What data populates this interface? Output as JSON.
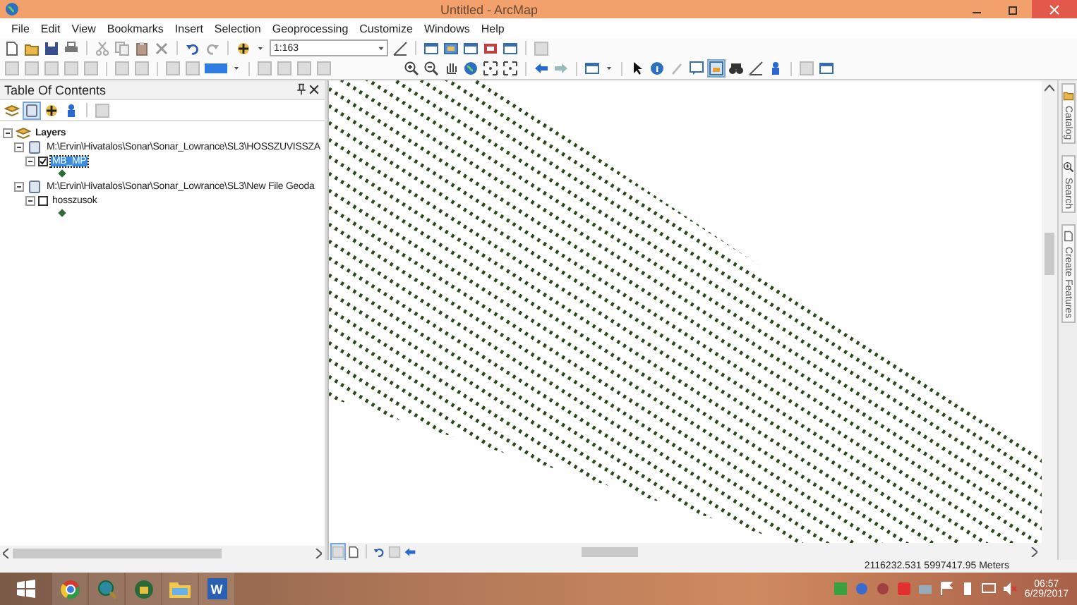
{
  "window": {
    "title": "Untitled - ArcMap"
  },
  "menu": [
    "File",
    "Edit",
    "View",
    "Bookmarks",
    "Insert",
    "Selection",
    "Geoprocessing",
    "Customize",
    "Windows",
    "Help"
  ],
  "toolbar": {
    "scale": "1:163"
  },
  "toc": {
    "title": "Table Of Contents",
    "tree": [
      {
        "kind": "root",
        "label": "Layers",
        "expanded": true,
        "selected": false,
        "children": [
          {
            "kind": "source",
            "label": "M:\\Ervin\\Hivatalos\\Sonar\\Sonar_Lowrance\\SL3\\HOSSZUVISSZA",
            "expanded": true,
            "selected": false,
            "children": [
              {
                "kind": "layer",
                "label": "MB_MP",
                "checked": true,
                "selected": true,
                "expanded": true
              }
            ]
          },
          {
            "kind": "source",
            "label": "M:\\Ervin\\Hivatalos\\Sonar\\Sonar_Lowrance\\SL3\\New File Geoda",
            "expanded": true,
            "selected": false,
            "children": [
              {
                "kind": "layer",
                "label": "hosszusok",
                "checked": false,
                "selected": false,
                "expanded": true
              }
            ]
          }
        ]
      }
    ]
  },
  "dock_tabs": [
    {
      "label": "Catalog"
    },
    {
      "label": "Search"
    },
    {
      "label": "Create Features"
    }
  ],
  "status_bar": {
    "coordinates": "2116232.531  5997417.95 Meters"
  },
  "taskbar": {
    "word_letter": "W",
    "time": "06:57",
    "date": "6/29/2017"
  }
}
